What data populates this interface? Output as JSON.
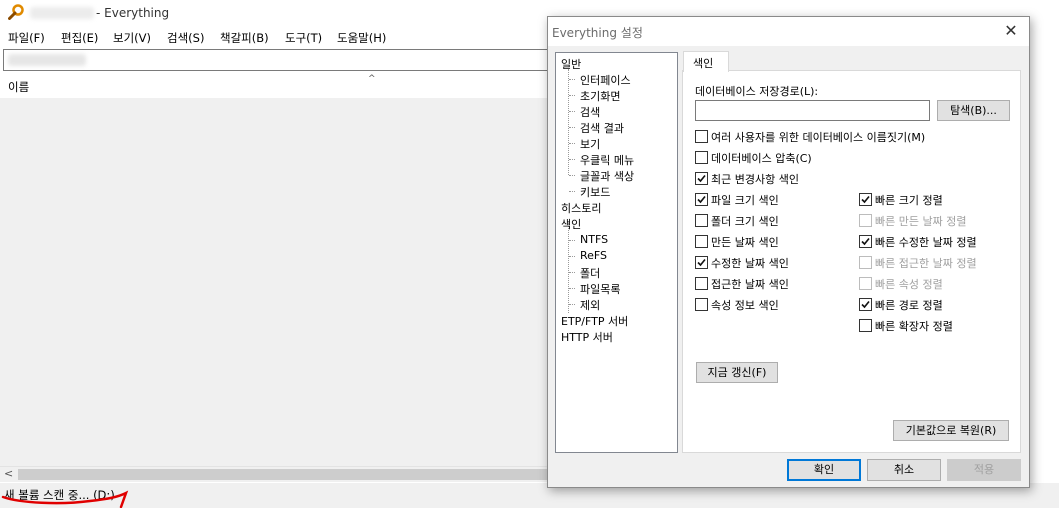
{
  "main": {
    "title": "- Everything",
    "menu": [
      "파일(F)",
      "편집(E)",
      "보기(V)",
      "검색(S)",
      "책갈피(B)",
      "도구(T)",
      "도움말(H)"
    ],
    "column_name": "이름",
    "scroll_left": "<",
    "sort_arrow": "^",
    "status": "새 볼륨 스캔 중... (D:)"
  },
  "dialog": {
    "title": "Everything 설정",
    "close": "✕",
    "tree": [
      {
        "label": "일반",
        "level": 0
      },
      {
        "label": "인터페이스",
        "level": 1
      },
      {
        "label": "초기화면",
        "level": 1
      },
      {
        "label": "검색",
        "level": 1
      },
      {
        "label": "검색 결과",
        "level": 1
      },
      {
        "label": "보기",
        "level": 1
      },
      {
        "label": "우클릭 메뉴",
        "level": 1
      },
      {
        "label": "글꼴과 색상",
        "level": 1
      },
      {
        "label": "키보드",
        "level": 1
      },
      {
        "label": "히스토리",
        "level": 0
      },
      {
        "label": "색인",
        "level": 0
      },
      {
        "label": "NTFS",
        "level": 1
      },
      {
        "label": "ReFS",
        "level": 1
      },
      {
        "label": "폴더",
        "level": 1
      },
      {
        "label": "파일목록",
        "level": 1
      },
      {
        "label": "제외",
        "level": 1
      },
      {
        "label": "ETP/FTP 서버",
        "level": 0
      },
      {
        "label": "HTTP 서버",
        "level": 0
      }
    ],
    "tab": "색인",
    "db_path_label": "데이터베이스 저장경로(L):",
    "db_path_value": "",
    "browse_button": "탐색(B)...",
    "full_checks": [
      {
        "label": "여러 사용자를 위한 데이터베이스 이름짓기(M)",
        "checked": false
      },
      {
        "label": "데이터베이스 압축(C)",
        "checked": false
      },
      {
        "label": "최근 변경사항 색인",
        "checked": true
      }
    ],
    "left_checks": [
      {
        "label": "파일 크기 색인",
        "checked": true
      },
      {
        "label": "폴더 크기 색인",
        "checked": false
      },
      {
        "label": "만든 날짜 색인",
        "checked": false
      },
      {
        "label": "수정한 날짜 색인",
        "checked": true
      },
      {
        "label": "접근한 날짜 색인",
        "checked": false
      },
      {
        "label": "속성 정보 색인",
        "checked": false
      }
    ],
    "right_checks": [
      {
        "label": "빠른 크기 정렬",
        "checked": true,
        "enabled": true
      },
      {
        "label": "빠른 만든 날짜 정렬",
        "checked": false,
        "enabled": false
      },
      {
        "label": "빠른 수정한 날짜 정렬",
        "checked": true,
        "enabled": true
      },
      {
        "label": "빠른 접근한 날짜 정렬",
        "checked": false,
        "enabled": false
      },
      {
        "label": "빠른 속성 정렬",
        "checked": false,
        "enabled": false
      },
      {
        "label": "빠른 경로 정렬",
        "checked": true,
        "enabled": true
      },
      {
        "label": "빠른 확장자 정렬",
        "checked": false,
        "enabled": true
      }
    ],
    "refresh_button": "지금 갱신(F)",
    "restore_button": "기본값으로 복원(R)",
    "ok_button": "확인",
    "cancel_button": "취소",
    "apply_button": "적용"
  },
  "icons": {
    "app": "magnifier-icon",
    "close": "close-icon",
    "check": "checkmark-icon"
  },
  "colors": {
    "accent": "#0078d7",
    "annotation": "#e00000",
    "app_icon": "#e08a00"
  }
}
